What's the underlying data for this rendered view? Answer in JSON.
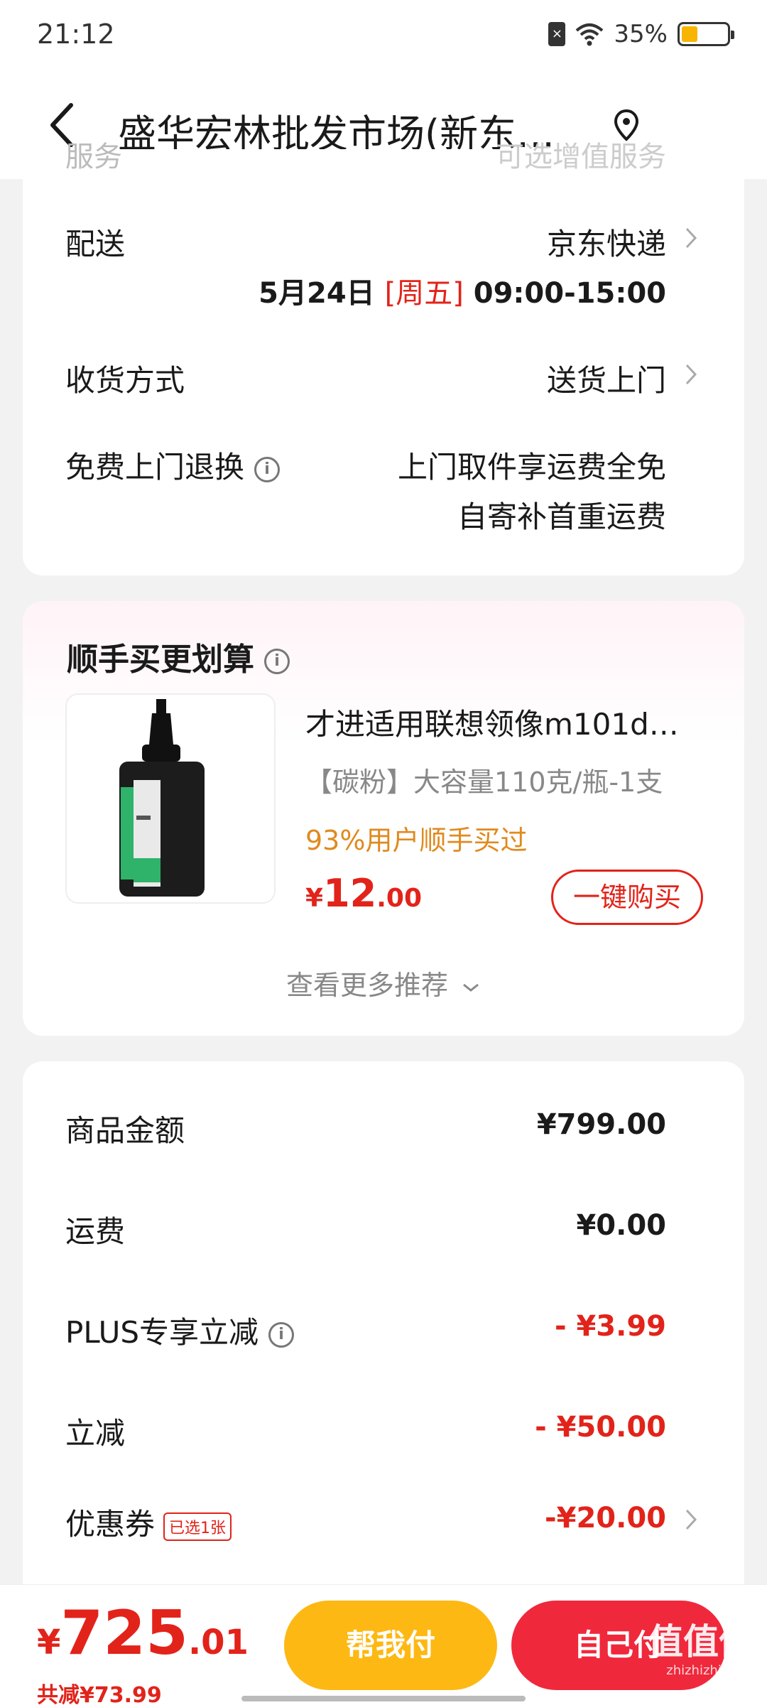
{
  "status_bar": {
    "time": "21:12",
    "battery_percent": "35%",
    "battery_level": 0.35
  },
  "header": {
    "title": "盛华宏林批发市场(新东…"
  },
  "service_card": {
    "clipped_label": "服务",
    "clipped_value": "可选增值服务",
    "delivery": {
      "label": "配送",
      "carrier": "京东快递",
      "date": "5月24日",
      "weekday": "[周五]",
      "time_window": "09:00-15:00"
    },
    "receive_method": {
      "label": "收货方式",
      "value": "送货上门"
    },
    "free_return": {
      "label": "免费上门退换",
      "line1": "上门取件享运费全免",
      "line2": "自寄补首重运费"
    }
  },
  "recommendation": {
    "title": "顺手买更划算",
    "product": {
      "name": "才进适用联想领像m101d…",
      "spec": "【碳粉】大容量110克/瓶-1支",
      "buyers": "93%用户顺手买过",
      "price_currency": "¥",
      "price_int": "12",
      "price_dec": ".00",
      "buy_label": "一键购买"
    },
    "more_label": "查看更多推荐"
  },
  "summary": {
    "rows": [
      {
        "label": "商品金额",
        "value": "¥799.00"
      },
      {
        "label": "运费",
        "value": "¥0.00"
      },
      {
        "label": "PLUS专享立减",
        "value": "- ¥3.99"
      },
      {
        "label": "立减",
        "value": "- ¥50.00"
      },
      {
        "label": "优惠券",
        "tag": "已选1张",
        "value": "-¥20.00"
      }
    ]
  },
  "bottom_bar": {
    "total_currency": "¥",
    "total_int": "725",
    "total_dec": ".01",
    "saved": "共减¥73.99",
    "help_pay": "帮我付",
    "self_pay": "自己付",
    "watermark": "值值值",
    "watermark_sub": "zhizhizhi.com"
  },
  "colors": {
    "accent_red": "#e2231a",
    "help_pay_yellow": "#fdb813",
    "self_pay_red": "#f0283c",
    "buyers_orange": "#e08a1e"
  }
}
